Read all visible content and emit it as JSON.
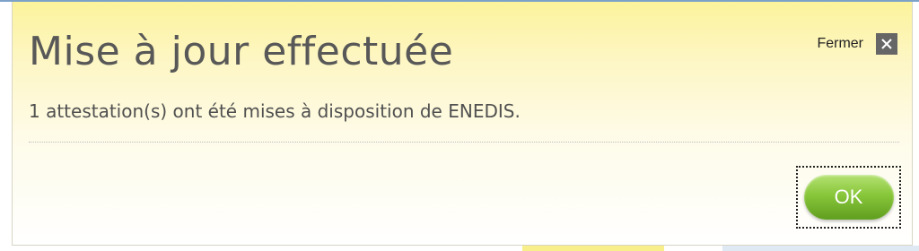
{
  "dialog": {
    "title": "Mise à jour effectuée",
    "close_label": "Fermer",
    "message": "1 attestation(s) ont été mises à disposition de ENEDIS.",
    "ok_label": "OK"
  },
  "icons": {
    "close": "close-icon"
  },
  "colors": {
    "header_gradient_top": "#fcf39b",
    "ok_button_green": "#88c63a",
    "close_icon_bg": "#666666",
    "text": "#585858"
  }
}
